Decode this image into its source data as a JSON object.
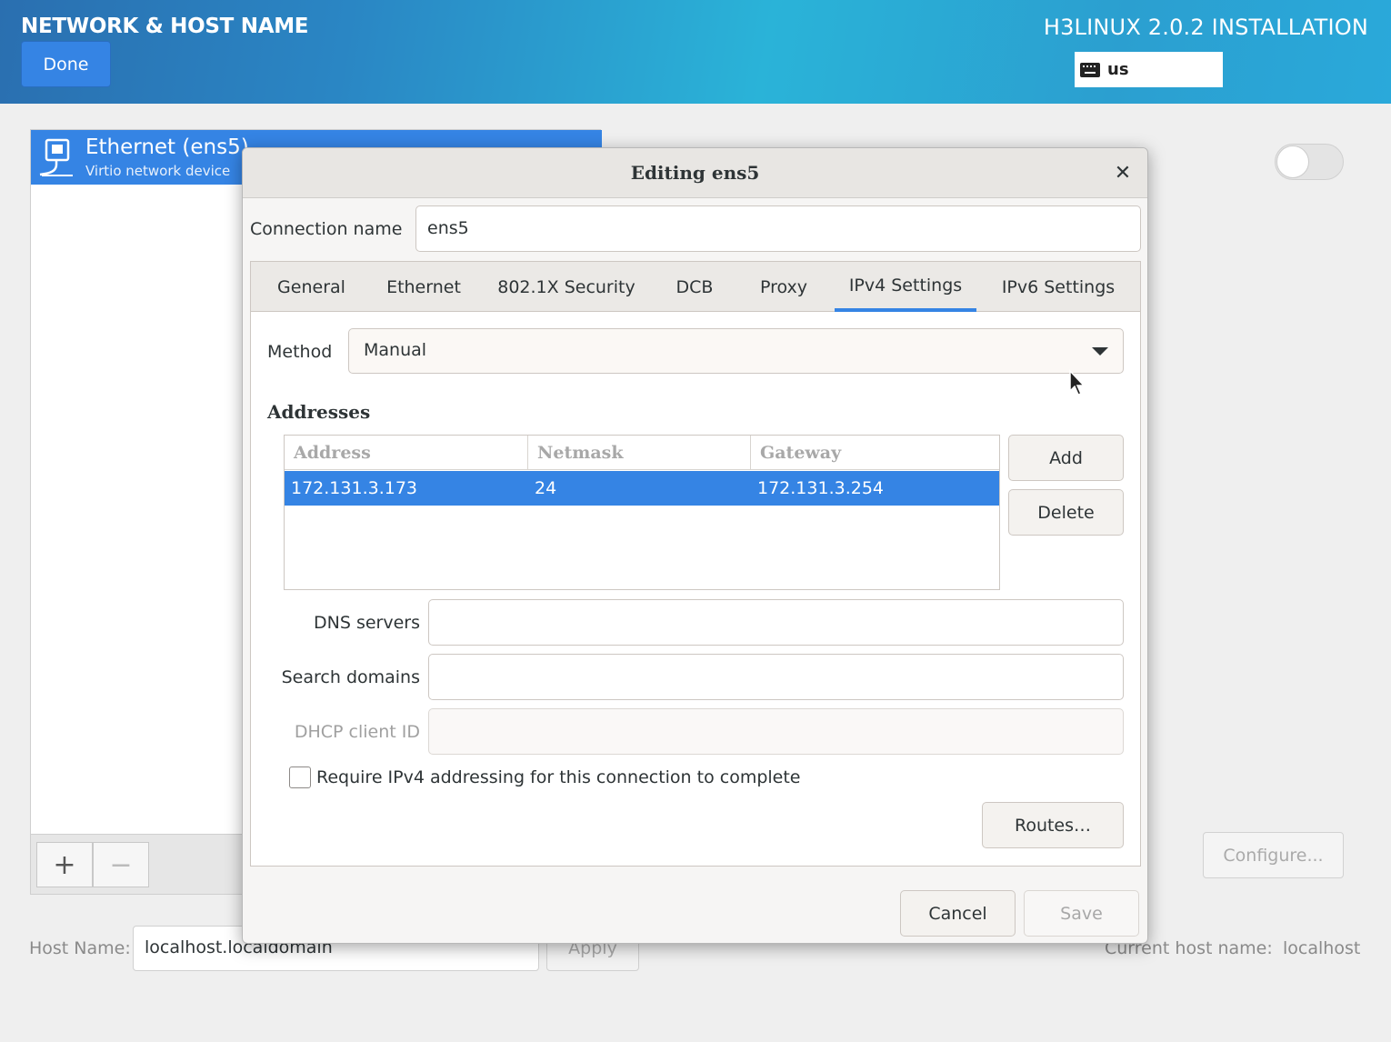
{
  "header": {
    "spoke_title": "NETWORK & HOST NAME",
    "done_label": "Done",
    "product_title": "H3LINUX 2.0.2 INSTALLATION",
    "keyboard_layout": "us",
    "gradient_colors": [
      "#2a6fb0",
      "#2ab3d8",
      "#2aa9da"
    ]
  },
  "device_list": {
    "items": [
      {
        "name": "Ethernet (ens5)",
        "description": "Virtio network device",
        "icon": "ethernet-icon",
        "selected": true
      }
    ],
    "add_label": "+",
    "remove_label": "−"
  },
  "device_panel": {
    "connection_toggle": "off",
    "configure_label": "Configure..."
  },
  "hostname": {
    "label": "Host Name:",
    "value": "localhost.localdomain",
    "apply_label": "Apply",
    "current_label": "Current host name:",
    "current_value": "localhost"
  },
  "dialog": {
    "title": "Editing ens5",
    "close_icon": "close-icon",
    "connection_name_label": "Connection name",
    "connection_name_value": "ens5",
    "tabs": [
      {
        "label": "General"
      },
      {
        "label": "Ethernet"
      },
      {
        "label": "802.1X Security"
      },
      {
        "label": "DCB"
      },
      {
        "label": "Proxy"
      },
      {
        "label": "IPv4 Settings",
        "active": true
      },
      {
        "label": "IPv6 Settings"
      }
    ],
    "ipv4": {
      "method_label": "Method",
      "method_value": "Manual",
      "addresses_label": "Addresses",
      "columns": [
        "Address",
        "Netmask",
        "Gateway"
      ],
      "rows": [
        {
          "address": "172.131.3.173",
          "netmask": "24",
          "gateway": "172.131.3.254",
          "selected": true
        }
      ],
      "add_label": "Add",
      "delete_label": "Delete",
      "dns_label": "DNS servers",
      "dns_value": "",
      "search_domains_label": "Search domains",
      "search_domains_value": "",
      "dhcp_client_id_label": "DHCP client ID",
      "dhcp_client_id_value": "",
      "require_label": "Require IPv4 addressing for this connection to complete",
      "require_checked": false,
      "routes_label": "Routes…"
    },
    "cancel_label": "Cancel",
    "save_label": "Save"
  },
  "colors": {
    "accent": "#3584e4"
  }
}
